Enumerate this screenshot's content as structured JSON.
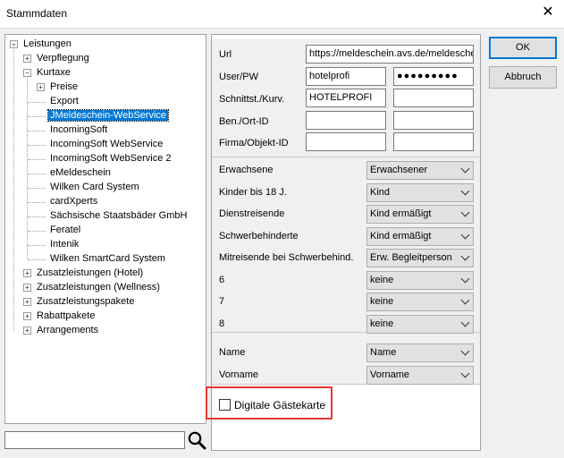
{
  "window": {
    "title": "Stammdaten",
    "close_glyph": "✕"
  },
  "tree": [
    {
      "label": "Leistungen",
      "expander": "−"
    },
    {
      "label": "Verpflegung",
      "expander": "+"
    },
    {
      "label": "Kurtaxe",
      "expander": "−"
    },
    {
      "label": "Preise",
      "expander": "+"
    },
    {
      "label": "Export"
    },
    {
      "label": "JMeldeschein-WebService",
      "selected": true
    },
    {
      "label": "IncomingSoft"
    },
    {
      "label": "IncomingSoft WebService"
    },
    {
      "label": "IncomingSoft WebService 2"
    },
    {
      "label": "eMeldeschein"
    },
    {
      "label": "Wilken Card System"
    },
    {
      "label": "cardXperts"
    },
    {
      "label": "Sächsische Staatsbäder GmbH"
    },
    {
      "label": "Feratel"
    },
    {
      "label": "Intenik"
    },
    {
      "label": "Wilken SmartCard System"
    },
    {
      "label": "Zusatzleistungen (Hotel)",
      "expander": "+"
    },
    {
      "label": "Zusatzleistungen (Wellness)",
      "expander": "+"
    },
    {
      "label": "Zusatzleistungspakete",
      "expander": "+"
    },
    {
      "label": "Rabattpakete",
      "expander": "+"
    },
    {
      "label": "Arrangements",
      "expander": "+"
    }
  ],
  "search": {
    "value": ""
  },
  "connection": {
    "url_label": "Url",
    "url_value": "https://meldeschein.avs.de/meldeschein",
    "user_label": "User/PW",
    "user_value": "hotelprofi",
    "pw_value": "●●●●●●●●●",
    "interface_label": "Schnittst./Kurv.",
    "interface_value": "HOTELPROFI",
    "interface_value2": "",
    "ben_label": "Ben./Ort-ID",
    "ben_value1": "",
    "ben_value2": "",
    "firma_label": "Firma/Objekt-ID",
    "firma_value1": "",
    "firma_value2": ""
  },
  "categories": [
    {
      "label": "Erwachsene",
      "value": "Erwachsener"
    },
    {
      "label": "Kinder bis 18 J.",
      "value": "Kind"
    },
    {
      "label": "Dienstreisende",
      "value": "Kind ermäßigt"
    },
    {
      "label": "Schwerbehinderte",
      "value": "Kind ermäßigt"
    },
    {
      "label": "Mitreisende bei Schwerbehind.",
      "value": "Erw. Begleitperson"
    },
    {
      "label": "6",
      "value": "keine"
    },
    {
      "label": "7",
      "value": "keine"
    },
    {
      "label": "8",
      "value": "keine"
    }
  ],
  "names": [
    {
      "label": "Name",
      "value": "Name"
    },
    {
      "label": "Vorname",
      "value": "Vorname"
    }
  ],
  "checkbox": {
    "label": "Digitale Gästekarte",
    "checked": false
  },
  "buttons": {
    "ok": "OK",
    "cancel": "Abbruch"
  },
  "colors": {
    "selection": "#0078d7",
    "highlight": "#e53935"
  }
}
